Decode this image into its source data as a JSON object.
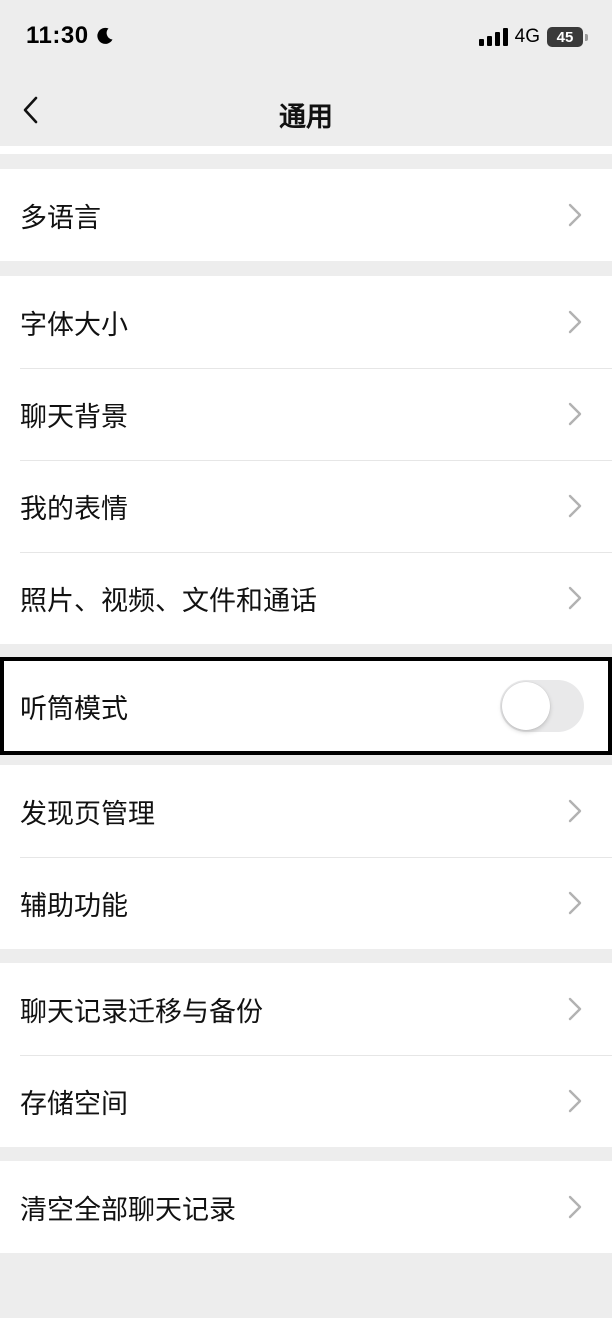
{
  "status_bar": {
    "time": "11:30",
    "network": "4G",
    "battery": "45"
  },
  "header": {
    "title": "通用"
  },
  "groups": [
    {
      "items": [
        {
          "label": "多语言"
        }
      ]
    },
    {
      "items": [
        {
          "label": "字体大小"
        },
        {
          "label": "聊天背景"
        },
        {
          "label": "我的表情"
        },
        {
          "label": "照片、视频、文件和通话"
        }
      ]
    },
    {
      "items": [
        {
          "label": "听筒模式",
          "toggle": false
        }
      ]
    },
    {
      "items": [
        {
          "label": "发现页管理"
        },
        {
          "label": "辅助功能"
        }
      ]
    },
    {
      "items": [
        {
          "label": "聊天记录迁移与备份"
        },
        {
          "label": "存储空间"
        }
      ]
    },
    {
      "items": [
        {
          "label": "清空全部聊天记录"
        }
      ]
    }
  ],
  "colors": {
    "background": "#ededed",
    "cell": "#ffffff",
    "chevron": "#b2b2b2",
    "toggle_off": "#e9e9ea",
    "highlight": "#000000"
  }
}
